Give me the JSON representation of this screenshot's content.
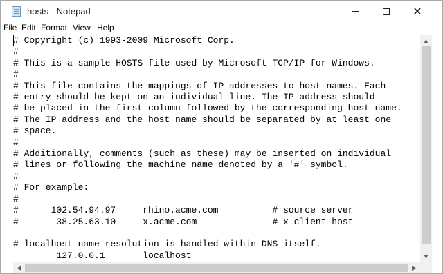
{
  "window": {
    "title": "hosts - Notepad"
  },
  "controls": {
    "minimize": "",
    "maximize": "",
    "close": "✕"
  },
  "menu": [
    "File",
    "Edit",
    "Format",
    "View",
    "Help"
  ],
  "document": {
    "lines": [
      "# Copyright (c) 1993-2009 Microsoft Corp.",
      "#",
      "# This is a sample HOSTS file used by Microsoft TCP/IP for Windows.",
      "#",
      "# This file contains the mappings of IP addresses to host names. Each",
      "# entry should be kept on an individual line. The IP address should",
      "# be placed in the first column followed by the corresponding host name.",
      "# The IP address and the host name should be separated by at least one",
      "# space.",
      "#",
      "# Additionally, comments (such as these) may be inserted on individual",
      "# lines or following the machine name denoted by a '#' symbol.",
      "#",
      "# For example:",
      "#",
      "#      102.54.94.97     rhino.acme.com          # source server",
      "#       38.25.63.10     x.acme.com              # x client host",
      "",
      "# localhost name resolution is handled within DNS itself.",
      "        127.0.0.1       localhost"
    ]
  },
  "scrollbars": {
    "up": "▲",
    "down": "▼",
    "left": "◀",
    "right": "▶"
  }
}
